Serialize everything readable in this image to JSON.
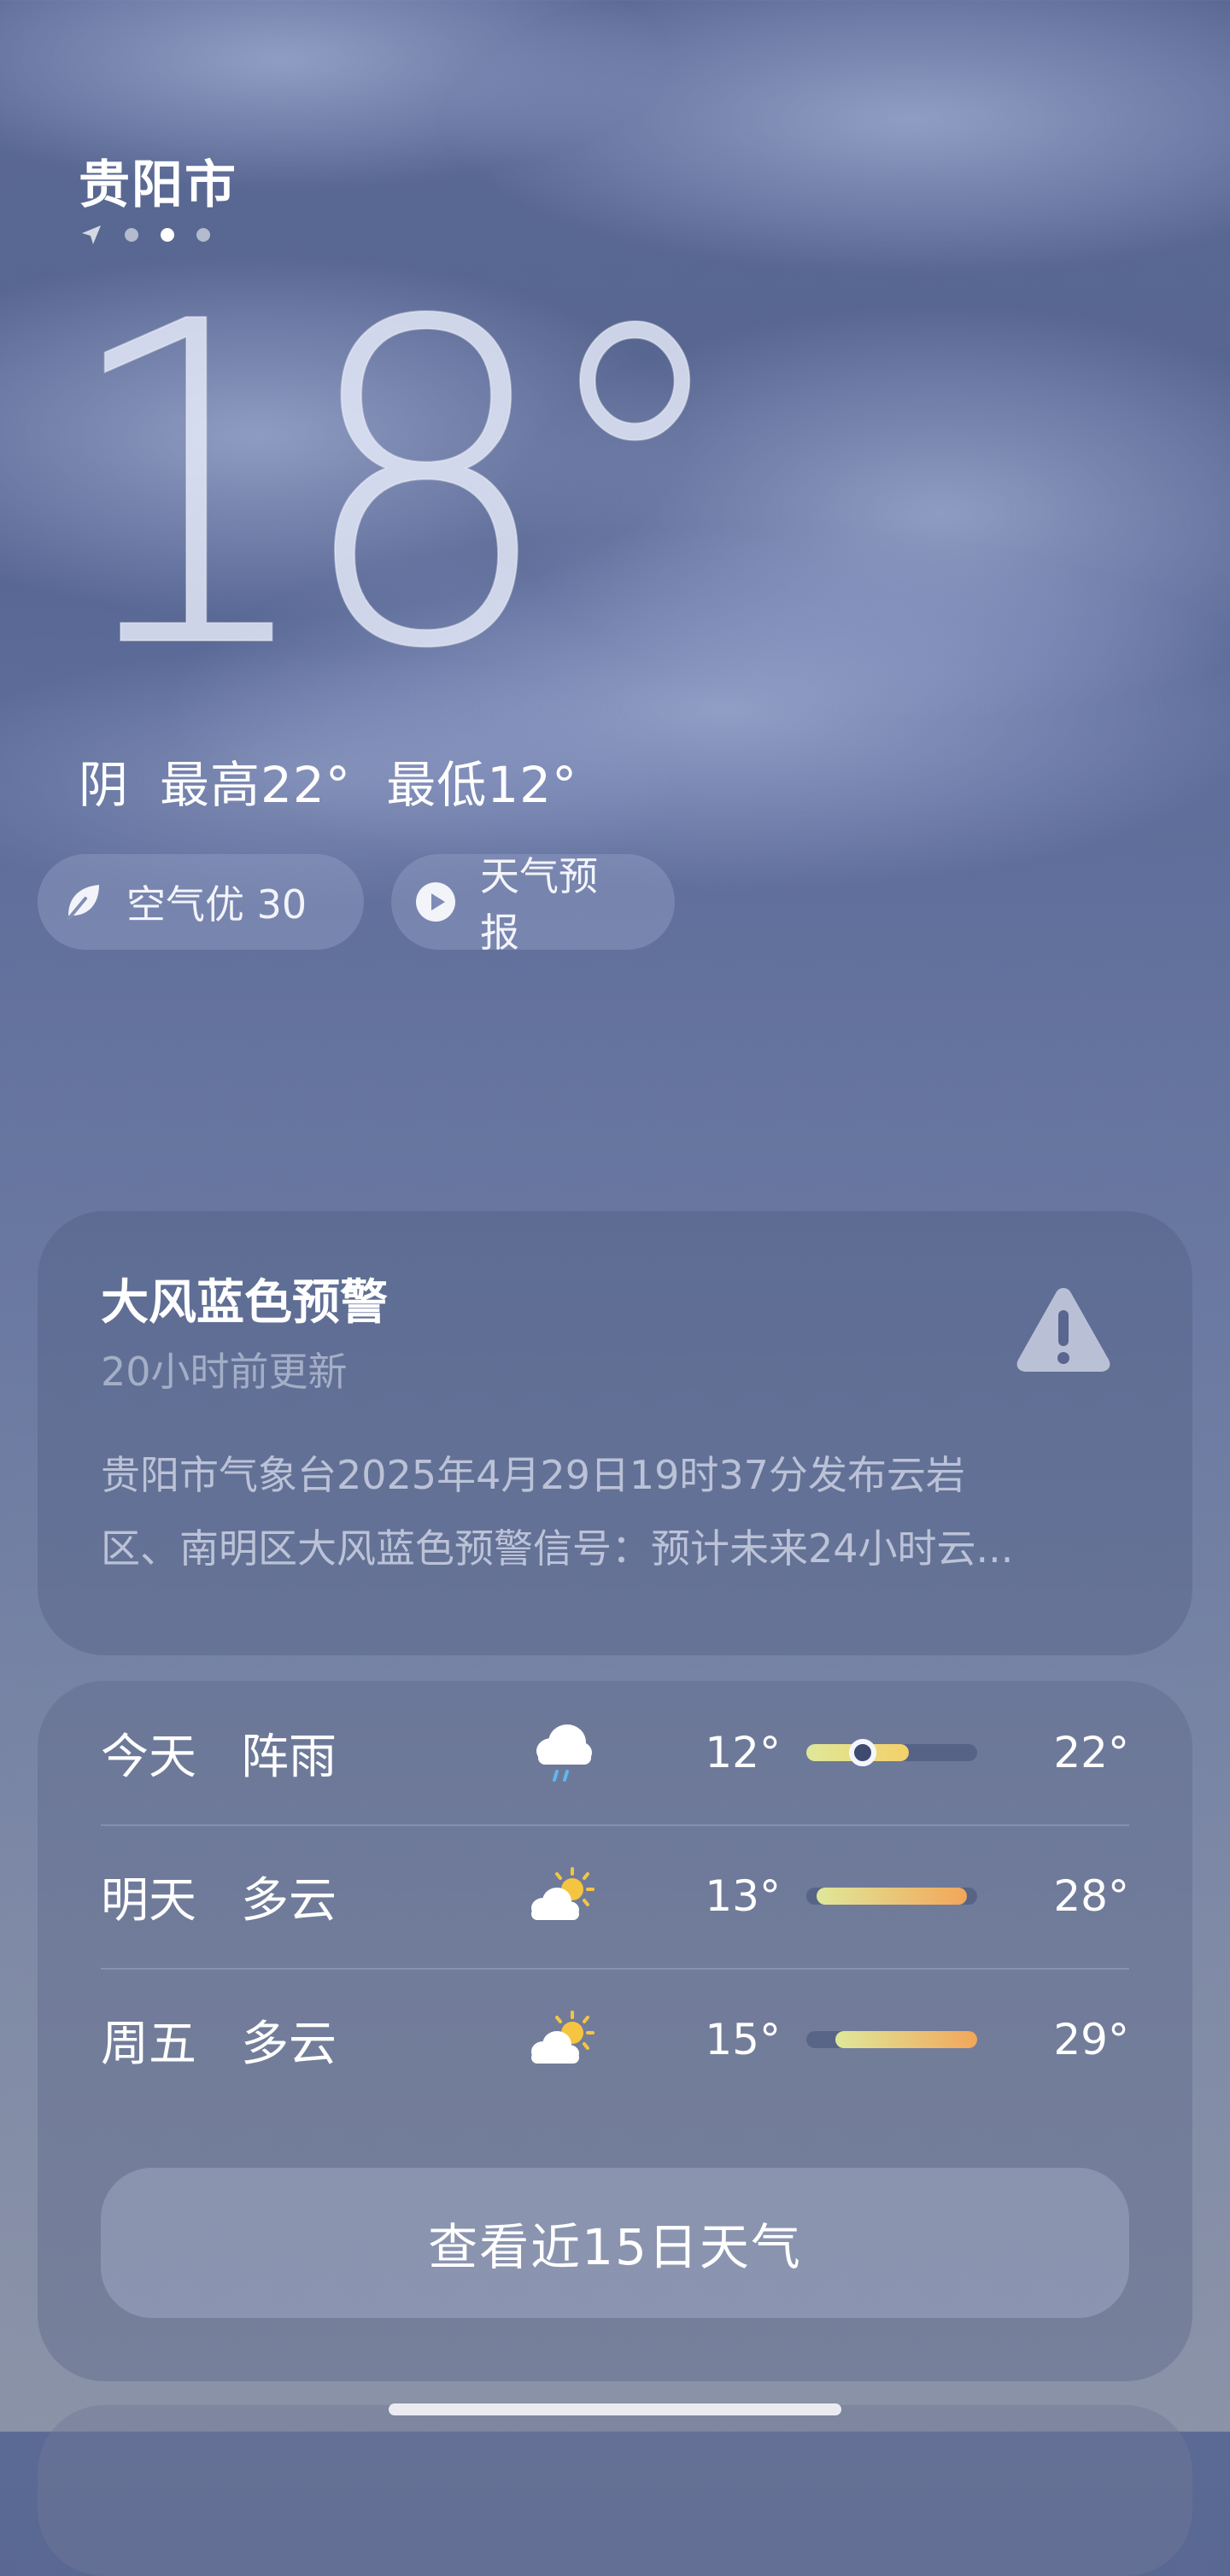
{
  "location": {
    "city": "贵阳市",
    "page_count": 3,
    "active_page": 2
  },
  "current": {
    "temperature": "18°",
    "condition": "阴",
    "high": "最高22°",
    "low": "最低12°"
  },
  "chips": {
    "air": {
      "label": "空气优 30",
      "icon": "leaf-icon"
    },
    "forecast": {
      "label": "天气预报",
      "icon": "play-icon"
    }
  },
  "warning": {
    "title": "大风蓝色预警",
    "updated": "20小时前更新",
    "body_line1": "贵阳市气象台2025年4月29日19时37分发布云岩",
    "body_line2": "区、南明区大风蓝色预警信号：预计未来24小时云...",
    "icon": "warning-triangle-icon"
  },
  "forecast": [
    {
      "day": "今天",
      "desc": "阵雨",
      "icon": "rain-cloud-icon",
      "low": "12°",
      "high": "22°",
      "bar_start": 0.0,
      "bar_end": 0.6,
      "now": 0.33
    },
    {
      "day": "明天",
      "desc": "多云",
      "icon": "partly-cloudy-icon",
      "low": "13°",
      "high": "28°",
      "bar_start": 0.06,
      "bar_end": 0.94
    },
    {
      "day": "周五",
      "desc": "多云",
      "icon": "partly-cloudy-icon",
      "low": "15°",
      "high": "29°",
      "bar_start": 0.17,
      "bar_end": 1.0
    }
  ],
  "view_15_days": "查看近15日天气",
  "colors": {
    "bar_cool": "#dfe89a",
    "bar_warm": "#f2a65a",
    "bar_mid": "#f4d06a"
  }
}
